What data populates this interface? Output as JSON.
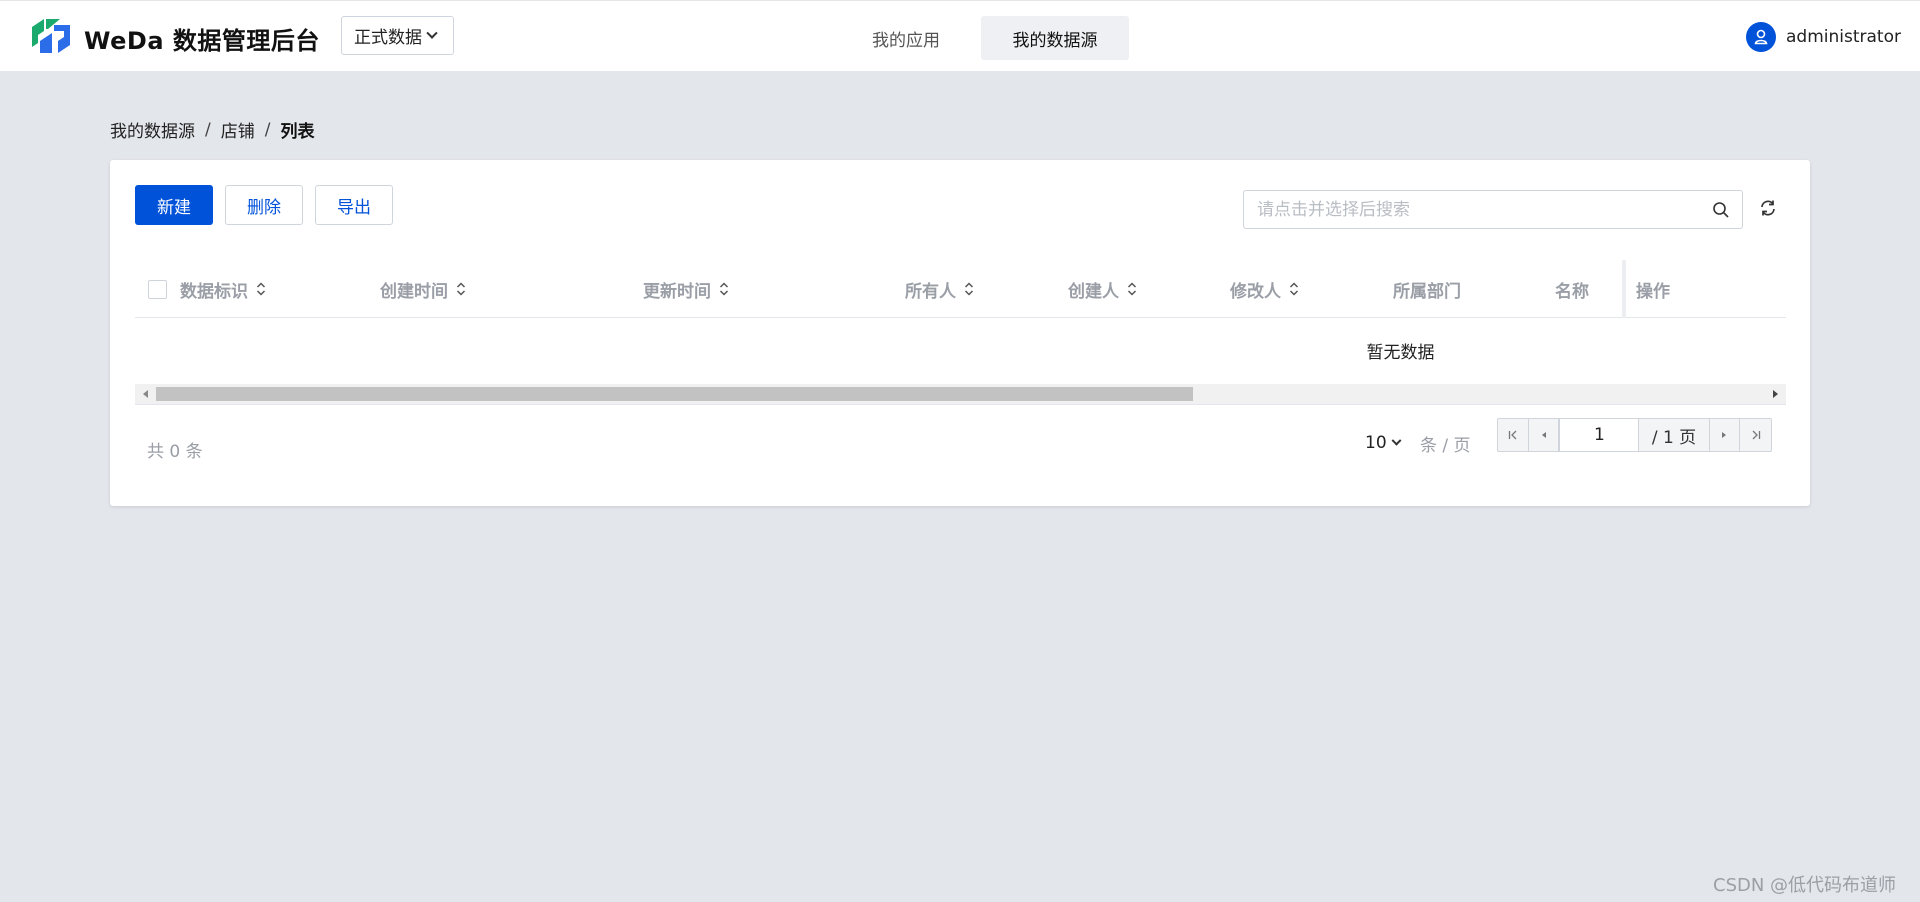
{
  "header": {
    "app_title": "WeDa 数据管理后台",
    "env_select": "正式数据",
    "nav": {
      "apps": "我的应用",
      "data_sources": "我的数据源"
    },
    "user": "administrator"
  },
  "breadcrumb": {
    "root": "我的数据源",
    "middle": "店铺",
    "current": "列表",
    "separator": "/"
  },
  "toolbar": {
    "new_label": "新建",
    "delete_label": "删除",
    "export_label": "导出",
    "search_placeholder": "请点击并选择后搜索"
  },
  "table": {
    "columns": [
      {
        "label": "数据标识",
        "sortable": true
      },
      {
        "label": "创建时间",
        "sortable": true
      },
      {
        "label": "更新时间",
        "sortable": true
      },
      {
        "label": "所有人",
        "sortable": true
      },
      {
        "label": "创建人",
        "sortable": true
      },
      {
        "label": "修改人",
        "sortable": true
      },
      {
        "label": "所属部门",
        "sortable": false
      },
      {
        "label": "名称",
        "sortable": false
      }
    ],
    "actions_column": "操作",
    "empty_text": "暂无数据"
  },
  "pagination": {
    "total_text": "共 0 条",
    "page_size": "10",
    "per_page_text": "条 / 页",
    "current_page": "1",
    "total_pages_text": "/ 1 页"
  },
  "colors": {
    "primary": "#0052d9",
    "background": "#e3e6eb"
  },
  "watermark": "CSDN @低代码布道师"
}
